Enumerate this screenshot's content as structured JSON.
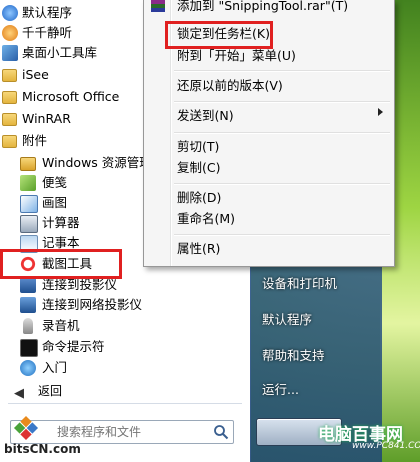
{
  "start_menu": {
    "programs": [
      {
        "label": "默认程序",
        "icon": "default-programs-icon",
        "level": "top"
      },
      {
        "label": "千千静听",
        "icon": "ttplayer-icon",
        "level": "top"
      },
      {
        "label": "桌面小工具库",
        "icon": "gadgets-icon",
        "level": "top"
      },
      {
        "label": "iSee",
        "icon": "folder-icon",
        "level": "top"
      },
      {
        "label": "Microsoft Office",
        "icon": "folder-icon",
        "level": "top"
      },
      {
        "label": "WinRAR",
        "icon": "folder-icon",
        "level": "top"
      },
      {
        "label": "附件",
        "icon": "folder-icon",
        "level": "top"
      },
      {
        "label": "Windows 资源管理器",
        "icon": "explorer-icon",
        "level": "sub"
      },
      {
        "label": "便笺",
        "icon": "sticky-notes-icon",
        "level": "sub"
      },
      {
        "label": "画图",
        "icon": "paint-icon",
        "level": "sub"
      },
      {
        "label": "计算器",
        "icon": "calculator-icon",
        "level": "sub"
      },
      {
        "label": "记事本",
        "icon": "notepad-icon",
        "level": "sub"
      },
      {
        "label": "截图工具",
        "icon": "snipping-tool-icon",
        "level": "sub"
      },
      {
        "label": "连接到投影仪",
        "icon": "projector-icon",
        "level": "sub"
      },
      {
        "label": "连接到网络投影仪",
        "icon": "network-projector-icon",
        "level": "sub"
      },
      {
        "label": "录音机",
        "icon": "sound-recorder-icon",
        "level": "sub"
      },
      {
        "label": "命令提示符",
        "icon": "cmd-icon",
        "level": "sub"
      },
      {
        "label": "入门",
        "icon": "getting-started-icon",
        "level": "sub"
      }
    ],
    "back_label": "返回",
    "search_placeholder": "搜索程序和文件",
    "right_pane": [
      "设备和打印机",
      "默认程序",
      "帮助和支持",
      "运行..."
    ]
  },
  "context_menu": {
    "items": [
      {
        "label": "添加到 \"SnippingTool.rar\"(T)",
        "has_submenu": false
      },
      {
        "label": "锁定到任务栏(K)",
        "has_submenu": false
      },
      {
        "label": "附到「开始」菜单(U)",
        "has_submenu": false
      },
      {
        "label": "还原以前的版本(V)",
        "has_submenu": false
      },
      {
        "label": "发送到(N)",
        "has_submenu": true
      },
      {
        "label": "剪切(T)",
        "has_submenu": false
      },
      {
        "label": "复制(C)",
        "has_submenu": false
      },
      {
        "label": "删除(D)",
        "has_submenu": false
      },
      {
        "label": "重命名(M)",
        "has_submenu": false
      },
      {
        "label": "属性(R)",
        "has_submenu": false
      }
    ]
  },
  "watermarks": {
    "left": "bitsCN.com",
    "right": "电脑百事网",
    "right_sub": "www.PC841.COM"
  },
  "colors": {
    "highlight": "#e02020",
    "right_pane": "#2c5d96",
    "desktop": "#9ad33e"
  }
}
